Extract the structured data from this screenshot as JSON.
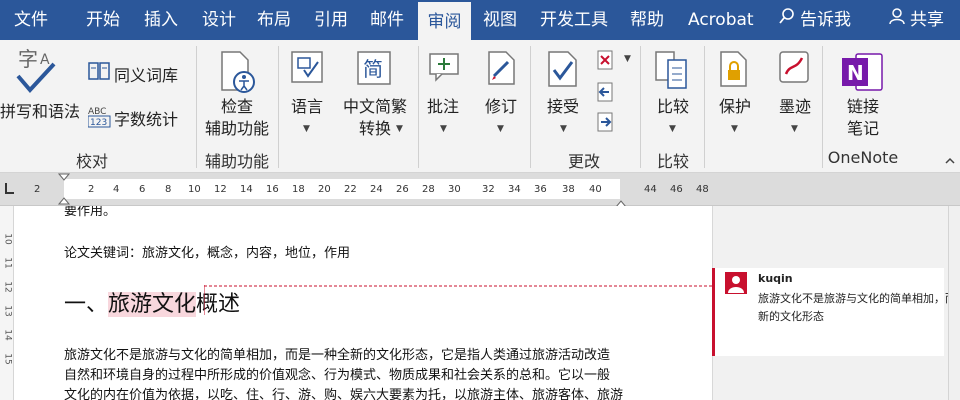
{
  "tabs": [
    {
      "label": "文件"
    },
    {
      "label": "开始"
    },
    {
      "label": "插入"
    },
    {
      "label": "设计"
    },
    {
      "label": "布局"
    },
    {
      "label": "引用"
    },
    {
      "label": "邮件"
    },
    {
      "label": "审阅"
    },
    {
      "label": "视图"
    },
    {
      "label": "开发工具"
    },
    {
      "label": "帮助"
    },
    {
      "label": "Acrobat"
    },
    {
      "label": "告诉我"
    },
    {
      "label": "共享"
    }
  ],
  "ribbon": {
    "spelling": "拼写和语法",
    "thesaurus": "同义词库",
    "wordcount": "字数统计",
    "group_proofing": "校对",
    "check_line1": "检查",
    "check_line2": "辅助功能",
    "group_accessibility": "辅助功能",
    "language": "语言",
    "chinese_line1": "中文简繁",
    "chinese_line2": "转换",
    "comment": "批注",
    "track": "修订",
    "accept": "接受",
    "group_changes": "更改",
    "compare": "比较",
    "group_compare": "比较",
    "protect": "保护",
    "ink": "墨迹",
    "link_line1": "链接",
    "link_line2": "笔记",
    "group_onenote": "OneNote"
  },
  "ruler": {
    "left_num": "2",
    "numbers": [
      "2",
      "4",
      "6",
      "8",
      "10",
      "12",
      "14",
      "16",
      "18",
      "20",
      "22",
      "24",
      "26",
      "28",
      "30",
      "32",
      "34",
      "36",
      "38",
      "40"
    ],
    "right_numbers": [
      "44",
      "46",
      "48"
    ],
    "vertical": [
      "10",
      "11",
      "12",
      "13",
      "14",
      "15"
    ]
  },
  "document": {
    "top_fragment": "要作用。",
    "keywords": "论文关键词：旅游文化，概念，内容，地位，作用",
    "heading_prefix": "一、",
    "heading_highlight": "旅游文化",
    "heading_suffix": "概述",
    "para_line1": "旅游文化不是旅游与文化的简单相加，而是一种全新的文化形态，它是指人类通过旅游活动改造",
    "para_line2": "自然和环境自身的过程中所形成的价值观念、行为模式、物质成果和社会关系的总和。它以一般",
    "para_line3": "文化的内在价值为依据，以吃、住、行、游、购、娱六大要素为托，以旅游主体、旅游客体、旅游"
  },
  "comment": {
    "author": "kuqin",
    "line1": "旅游文化不是旅游与文化的简单相加，而是一种全",
    "line2": "新的文化形态"
  },
  "colors": {
    "accent": "#2b579a",
    "comment": "#c8102e",
    "onenote": "#7719aa"
  }
}
